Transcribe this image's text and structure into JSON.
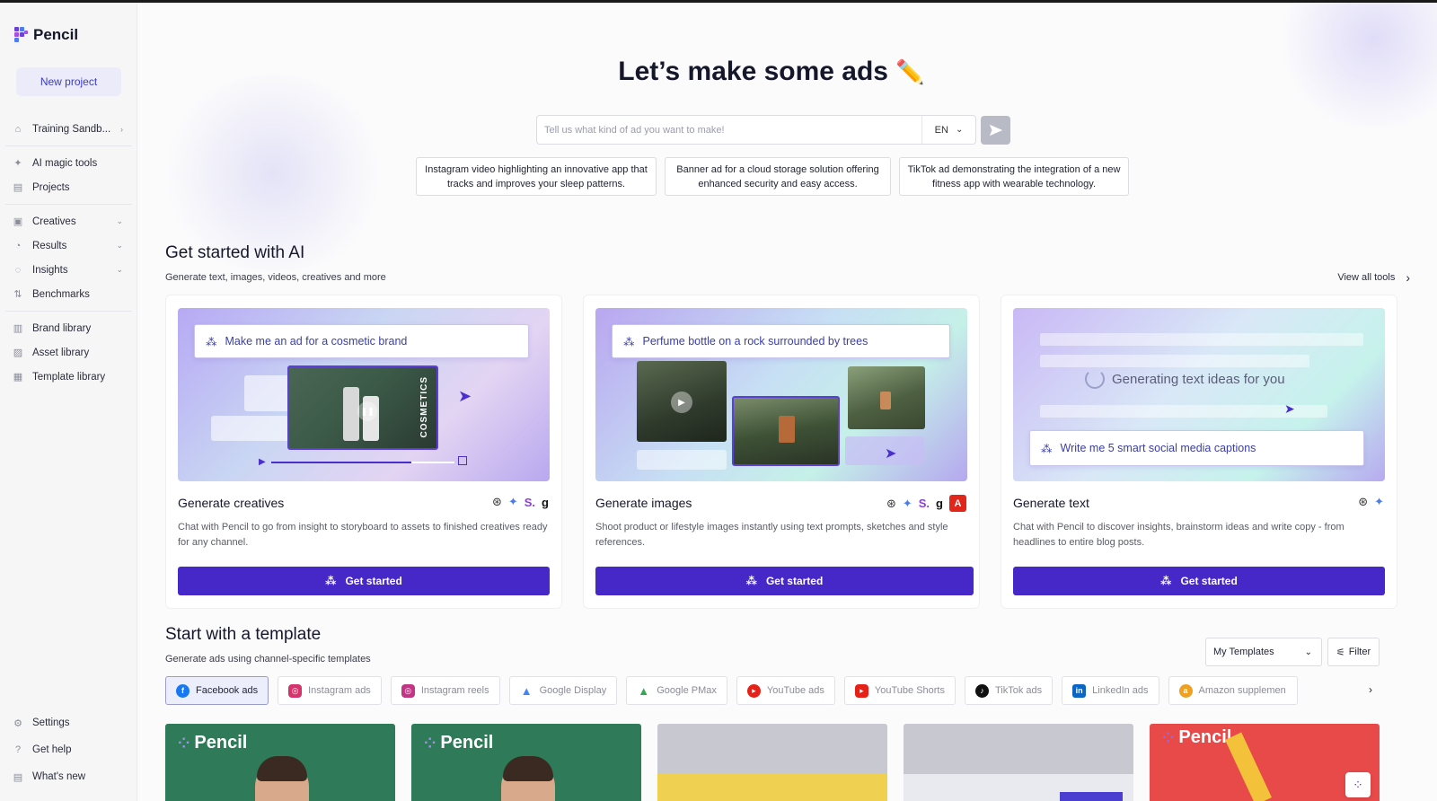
{
  "app": {
    "name": "Pencil"
  },
  "sidebar": {
    "new_project": "New project",
    "workspace": "Training Sandb...",
    "items_top": [
      {
        "label": "AI magic tools",
        "icon": "magic-wand-icon"
      },
      {
        "label": "Projects",
        "icon": "document-icon"
      }
    ],
    "items_mid": [
      {
        "label": "Creatives",
        "icon": "image-icon"
      },
      {
        "label": "Results",
        "icon": "gauge-icon"
      },
      {
        "label": "Insights",
        "icon": "lightbulb-icon"
      },
      {
        "label": "Benchmarks",
        "icon": "sort-icon"
      }
    ],
    "items_lib": [
      {
        "label": "Brand library",
        "icon": "book-icon"
      },
      {
        "label": "Asset library",
        "icon": "image-icon"
      },
      {
        "label": "Template library",
        "icon": "layout-icon"
      }
    ],
    "items_bottom": [
      {
        "label": "Settings",
        "icon": "gear-icon"
      },
      {
        "label": "Get help",
        "icon": "help-icon"
      },
      {
        "label": "What's new",
        "icon": "news-icon"
      }
    ]
  },
  "hero": {
    "title": "Let’s make some ads",
    "search_placeholder": "Tell us what kind of ad you want to make!",
    "language": "EN",
    "suggestions": [
      "Instagram video highlighting an innovative app that tracks and improves your sleep patterns.",
      "Banner ad for a cloud storage solution offering enhanced security and easy access.",
      "TikTok ad demonstrating the integration of a new fitness app with wearable technology."
    ]
  },
  "ai_section": {
    "title": "Get started with AI",
    "subtitle": "Generate text, images, videos, creatives and more",
    "view_all": "View all tools",
    "cards": [
      {
        "prompt": "Make me an ad for a cosmetic brand",
        "title": "Generate creatives",
        "desc": "Chat with Pencil to go from insight to storyboard to assets to finished creatives ready for any channel.",
        "button": "Get started",
        "product_label": "COSMETICS"
      },
      {
        "prompt": "Perfume bottle on a rock surrounded by trees",
        "title": "Generate images",
        "desc": "Shoot product or lifestyle images instantly using text prompts, sketches and style references.",
        "button": "Get started"
      },
      {
        "prompt": "Write me 5 smart social media captions",
        "status": "Generating text ideas for you",
        "title": "Generate text",
        "desc": "Chat with Pencil to discover insights, brainstorm ideas and write copy - from headlines to entire blog posts.",
        "button": "Get started"
      }
    ]
  },
  "template_section": {
    "title": "Start with a template",
    "subtitle": "Generate ads using channel-specific templates",
    "selector": "My Templates",
    "filter": "Filter",
    "channels": [
      {
        "label": "Facebook ads",
        "color": "#1877f2",
        "active": true
      },
      {
        "label": "Instagram ads",
        "color": "#d6336c",
        "active": false
      },
      {
        "label": "Instagram reels",
        "color": "#c13584",
        "active": false
      },
      {
        "label": "Google Display",
        "color": "#4285f4",
        "active": false
      },
      {
        "label": "Google PMax",
        "color": "#34a853",
        "active": false
      },
      {
        "label": "YouTube ads",
        "color": "#e62117",
        "active": false
      },
      {
        "label": "YouTube Shorts",
        "color": "#e62117",
        "active": false
      },
      {
        "label": "TikTok ads",
        "color": "#111111",
        "active": false
      },
      {
        "label": "LinkedIn ads",
        "color": "#0a66c2",
        "active": false
      },
      {
        "label": "Amazon supplemen",
        "color": "#f0a020",
        "active": false
      }
    ],
    "thumbnails": [
      {
        "logo": "Pencil"
      },
      {
        "logo": "Pencil"
      },
      {
        "logo": ""
      },
      {
        "logo": ""
      },
      {
        "logo": "Pencil"
      }
    ]
  },
  "colors": {
    "accent": "#4628c8",
    "accent_light": "#ebebfa"
  }
}
